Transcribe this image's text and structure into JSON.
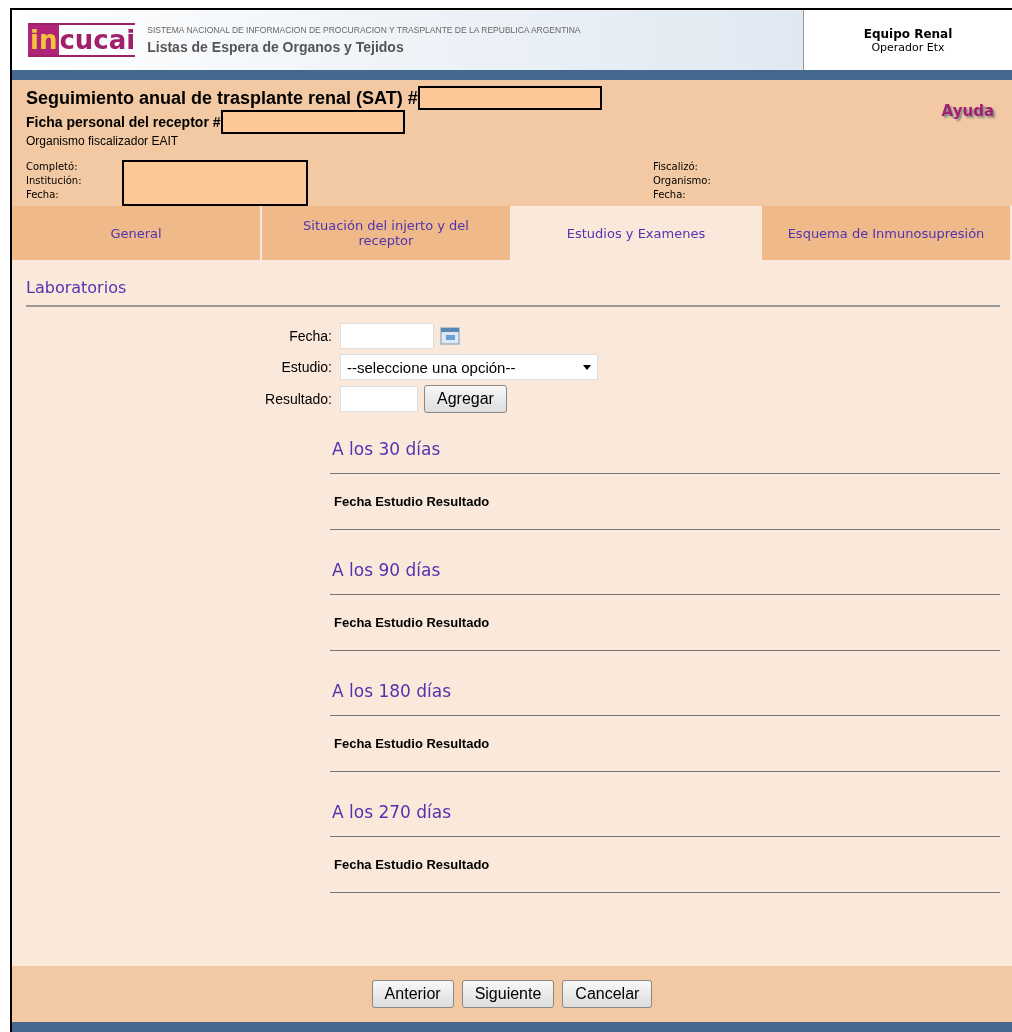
{
  "header": {
    "logo_mark": "in",
    "logo_text": "cucai",
    "system_name": "SISTEMA NACIONAL DE INFORMACION DE PROCURACION Y TRASPLANTE DE LA REPUBLICA ARGENTINA",
    "app_title": "Listas de Espera de Organos y Tejidos",
    "team": "Equipo Renal",
    "operator": "Operador Etx"
  },
  "record": {
    "title": "Seguimiento anual de trasplante renal (SAT) #",
    "subtitle": "Ficha personal del receptor #",
    "organism": "Organismo fiscalizador EAIT",
    "help": "Ayuda",
    "left_labels": [
      "Completó:",
      "Institución:",
      "Fecha:"
    ],
    "right_labels": [
      "Fiscalizó:",
      "Organismo:",
      "Fecha:"
    ]
  },
  "tabs": [
    {
      "label": "General",
      "selected": false
    },
    {
      "label": "Situación del injerto y del receptor",
      "selected": false
    },
    {
      "label": "Estudios y Examenes",
      "selected": true
    },
    {
      "label": "Esquema de Inmunosupresión",
      "selected": false
    }
  ],
  "section_title": "Laboratorios",
  "form": {
    "date_label": "Fecha:",
    "study_label": "Estudio:",
    "study_value": "--seleccione una opción--",
    "result_label": "Resultado:",
    "add_button": "Agregar"
  },
  "periods": [
    {
      "title": "A los 30 días",
      "columns": "Fecha Estudio Resultado"
    },
    {
      "title": "A los 90 días",
      "columns": "Fecha Estudio Resultado"
    },
    {
      "title": "A los 180 días",
      "columns": "Fecha Estudio Resultado"
    },
    {
      "title": "A los 270 días",
      "columns": "Fecha Estudio Resultado"
    }
  ],
  "buttons": [
    "Anterior",
    "Siguiente",
    "Cancelar"
  ]
}
